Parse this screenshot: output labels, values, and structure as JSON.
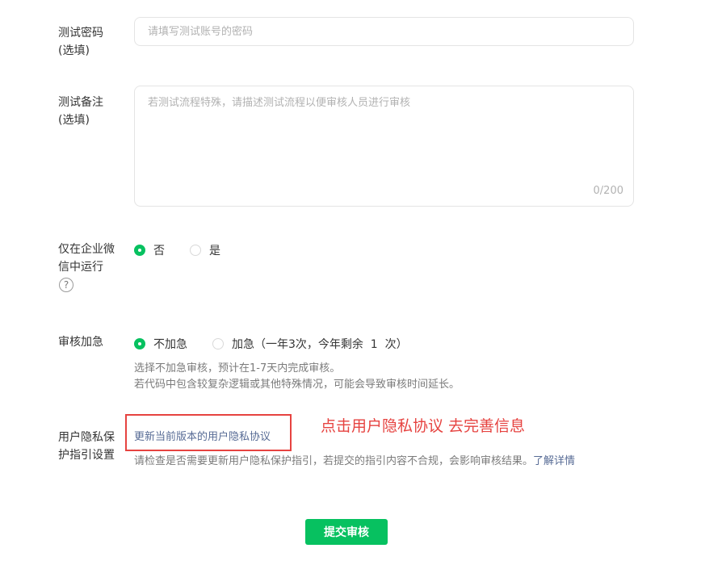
{
  "test_password": {
    "label_line1": "测试密码",
    "label_line2": "(选填)",
    "placeholder": "请填写测试账号的密码"
  },
  "test_note": {
    "label_line1": "测试备注",
    "label_line2": "(选填)",
    "placeholder": "若测试流程特殊，请描述测试流程以便审核人员进行审核",
    "counter": "0/200"
  },
  "wecom_only": {
    "label_line1": "仅在企业微",
    "label_line2": "信中运行",
    "help_icon": "question-circle-icon",
    "help_glyph": "?",
    "options": [
      {
        "label": "否",
        "checked": true
      },
      {
        "label": "是",
        "checked": false
      }
    ]
  },
  "review_priority": {
    "label": "审核加急",
    "options": [
      {
        "label": "不加急",
        "checked": true
      },
      {
        "label": "加急（一年3次，今年剩余  1  次）",
        "checked": false
      }
    ],
    "tip_line1": "选择不加急审核，预计在1-7天内完成审核。",
    "tip_line2": "若代码中包含较复杂逻辑或其他特殊情况，可能会导致审核时间延长。"
  },
  "privacy": {
    "label_line1": "用户隐私保",
    "label_line2": "护指引设置",
    "update_link": "更新当前版本的用户隐私协议",
    "tip": "请检查是否需要更新用户隐私保护指引，若提交的指引内容不合规，会影响审核结果。",
    "learn_more": "了解详情"
  },
  "annotation": "点击用户隐私协议 去完善信息",
  "submit_label": "提交审核",
  "colors": {
    "accent": "#07c160",
    "link": "#576b95",
    "annotation_red": "#e64340"
  }
}
